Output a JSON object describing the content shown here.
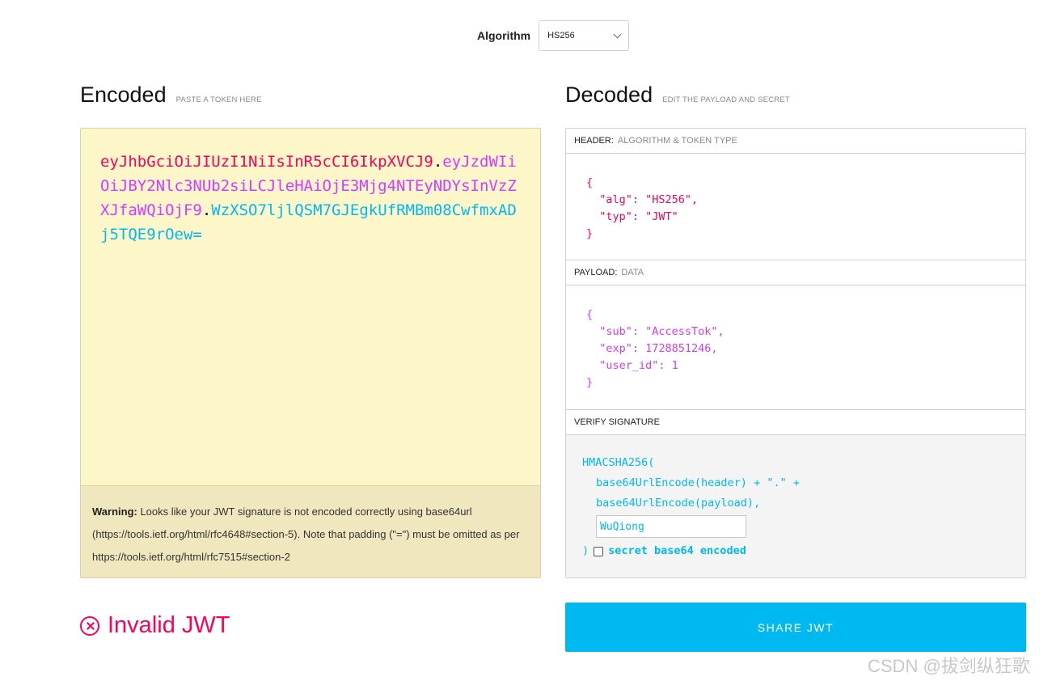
{
  "algorithm": {
    "label": "Algorithm",
    "selected": "HS256"
  },
  "encoded": {
    "title": "Encoded",
    "subtitle": "PASTE A TOKEN HERE",
    "token_parts": {
      "header": "eyJhbGciOiJIUzI1NiIsInR5cCI6IkpXVCJ9",
      "dot1": ".",
      "payload": "eyJzdWIiOiJBY2Nlc3NUb2siLCJleHAiOjE3Mjg4NTEyNDYsInVzZXJfaWQiOjF9",
      "dot2": ".",
      "signature": "WzXSO7ljlQSM7GJEgkUfRMBm08CwfmxADj5TQE9rOew="
    },
    "warning": {
      "label": "Warning:",
      "text": " Looks like your JWT signature is not encoded correctly using base64url (https://tools.ietf.org/html/rfc4648#section-5). Note that padding (\"=\") must be omitted as per https://tools.ietf.org/html/rfc7515#section-2"
    }
  },
  "decoded": {
    "title": "Decoded",
    "subtitle": "EDIT THE PAYLOAD AND SECRET",
    "header_section": {
      "label": "HEADER:",
      "sub": "ALGORITHM & TOKEN TYPE",
      "json": "{\n  \"alg\": \"HS256\",\n  \"typ\": \"JWT\"\n}"
    },
    "payload_section": {
      "label": "PAYLOAD:",
      "sub": "DATA",
      "json": "{\n  \"sub\": \"AccessTok\",\n  \"exp\": 1728851246,\n  \"user_id\": 1\n}"
    },
    "verify_section": {
      "label": "VERIFY SIGNATURE",
      "line1": "HMACSHA256(",
      "line2": "base64UrlEncode(header) + \".\" +",
      "line3": "base64UrlEncode(payload),",
      "secret_value": "WuQiong",
      "close_paren": ")",
      "checkbox_label": "secret base64 encoded",
      "checkbox_checked": false
    }
  },
  "status": {
    "text": "Invalid JWT",
    "color": "#fb015b"
  },
  "share_button": "SHARE JWT",
  "watermark": "CSDN @拔剑纵狂歌",
  "colors": {
    "header": "#fb015b",
    "payload": "#d63aff",
    "signature": "#00b9f1",
    "encoded_bg": "#fdf6c9"
  }
}
